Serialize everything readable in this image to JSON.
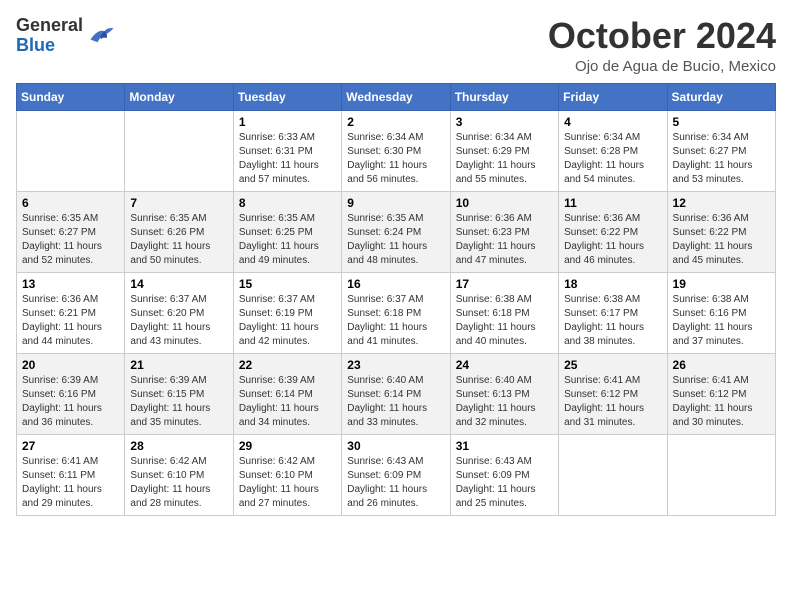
{
  "header": {
    "logo_general": "General",
    "logo_blue": "Blue",
    "month_title": "October 2024",
    "subtitle": "Ojo de Agua de Bucio, Mexico"
  },
  "weekdays": [
    "Sunday",
    "Monday",
    "Tuesday",
    "Wednesday",
    "Thursday",
    "Friday",
    "Saturday"
  ],
  "weeks": [
    [
      {
        "day": "",
        "sunrise": "",
        "sunset": "",
        "daylight": ""
      },
      {
        "day": "",
        "sunrise": "",
        "sunset": "",
        "daylight": ""
      },
      {
        "day": "1",
        "sunrise": "Sunrise: 6:33 AM",
        "sunset": "Sunset: 6:31 PM",
        "daylight": "Daylight: 11 hours and 57 minutes."
      },
      {
        "day": "2",
        "sunrise": "Sunrise: 6:34 AM",
        "sunset": "Sunset: 6:30 PM",
        "daylight": "Daylight: 11 hours and 56 minutes."
      },
      {
        "day": "3",
        "sunrise": "Sunrise: 6:34 AM",
        "sunset": "Sunset: 6:29 PM",
        "daylight": "Daylight: 11 hours and 55 minutes."
      },
      {
        "day": "4",
        "sunrise": "Sunrise: 6:34 AM",
        "sunset": "Sunset: 6:28 PM",
        "daylight": "Daylight: 11 hours and 54 minutes."
      },
      {
        "day": "5",
        "sunrise": "Sunrise: 6:34 AM",
        "sunset": "Sunset: 6:27 PM",
        "daylight": "Daylight: 11 hours and 53 minutes."
      }
    ],
    [
      {
        "day": "6",
        "sunrise": "Sunrise: 6:35 AM",
        "sunset": "Sunset: 6:27 PM",
        "daylight": "Daylight: 11 hours and 52 minutes."
      },
      {
        "day": "7",
        "sunrise": "Sunrise: 6:35 AM",
        "sunset": "Sunset: 6:26 PM",
        "daylight": "Daylight: 11 hours and 50 minutes."
      },
      {
        "day": "8",
        "sunrise": "Sunrise: 6:35 AM",
        "sunset": "Sunset: 6:25 PM",
        "daylight": "Daylight: 11 hours and 49 minutes."
      },
      {
        "day": "9",
        "sunrise": "Sunrise: 6:35 AM",
        "sunset": "Sunset: 6:24 PM",
        "daylight": "Daylight: 11 hours and 48 minutes."
      },
      {
        "day": "10",
        "sunrise": "Sunrise: 6:36 AM",
        "sunset": "Sunset: 6:23 PM",
        "daylight": "Daylight: 11 hours and 47 minutes."
      },
      {
        "day": "11",
        "sunrise": "Sunrise: 6:36 AM",
        "sunset": "Sunset: 6:22 PM",
        "daylight": "Daylight: 11 hours and 46 minutes."
      },
      {
        "day": "12",
        "sunrise": "Sunrise: 6:36 AM",
        "sunset": "Sunset: 6:22 PM",
        "daylight": "Daylight: 11 hours and 45 minutes."
      }
    ],
    [
      {
        "day": "13",
        "sunrise": "Sunrise: 6:36 AM",
        "sunset": "Sunset: 6:21 PM",
        "daylight": "Daylight: 11 hours and 44 minutes."
      },
      {
        "day": "14",
        "sunrise": "Sunrise: 6:37 AM",
        "sunset": "Sunset: 6:20 PM",
        "daylight": "Daylight: 11 hours and 43 minutes."
      },
      {
        "day": "15",
        "sunrise": "Sunrise: 6:37 AM",
        "sunset": "Sunset: 6:19 PM",
        "daylight": "Daylight: 11 hours and 42 minutes."
      },
      {
        "day": "16",
        "sunrise": "Sunrise: 6:37 AM",
        "sunset": "Sunset: 6:18 PM",
        "daylight": "Daylight: 11 hours and 41 minutes."
      },
      {
        "day": "17",
        "sunrise": "Sunrise: 6:38 AM",
        "sunset": "Sunset: 6:18 PM",
        "daylight": "Daylight: 11 hours and 40 minutes."
      },
      {
        "day": "18",
        "sunrise": "Sunrise: 6:38 AM",
        "sunset": "Sunset: 6:17 PM",
        "daylight": "Daylight: 11 hours and 38 minutes."
      },
      {
        "day": "19",
        "sunrise": "Sunrise: 6:38 AM",
        "sunset": "Sunset: 6:16 PM",
        "daylight": "Daylight: 11 hours and 37 minutes."
      }
    ],
    [
      {
        "day": "20",
        "sunrise": "Sunrise: 6:39 AM",
        "sunset": "Sunset: 6:16 PM",
        "daylight": "Daylight: 11 hours and 36 minutes."
      },
      {
        "day": "21",
        "sunrise": "Sunrise: 6:39 AM",
        "sunset": "Sunset: 6:15 PM",
        "daylight": "Daylight: 11 hours and 35 minutes."
      },
      {
        "day": "22",
        "sunrise": "Sunrise: 6:39 AM",
        "sunset": "Sunset: 6:14 PM",
        "daylight": "Daylight: 11 hours and 34 minutes."
      },
      {
        "day": "23",
        "sunrise": "Sunrise: 6:40 AM",
        "sunset": "Sunset: 6:14 PM",
        "daylight": "Daylight: 11 hours and 33 minutes."
      },
      {
        "day": "24",
        "sunrise": "Sunrise: 6:40 AM",
        "sunset": "Sunset: 6:13 PM",
        "daylight": "Daylight: 11 hours and 32 minutes."
      },
      {
        "day": "25",
        "sunrise": "Sunrise: 6:41 AM",
        "sunset": "Sunset: 6:12 PM",
        "daylight": "Daylight: 11 hours and 31 minutes."
      },
      {
        "day": "26",
        "sunrise": "Sunrise: 6:41 AM",
        "sunset": "Sunset: 6:12 PM",
        "daylight": "Daylight: 11 hours and 30 minutes."
      }
    ],
    [
      {
        "day": "27",
        "sunrise": "Sunrise: 6:41 AM",
        "sunset": "Sunset: 6:11 PM",
        "daylight": "Daylight: 11 hours and 29 minutes."
      },
      {
        "day": "28",
        "sunrise": "Sunrise: 6:42 AM",
        "sunset": "Sunset: 6:10 PM",
        "daylight": "Daylight: 11 hours and 28 minutes."
      },
      {
        "day": "29",
        "sunrise": "Sunrise: 6:42 AM",
        "sunset": "Sunset: 6:10 PM",
        "daylight": "Daylight: 11 hours and 27 minutes."
      },
      {
        "day": "30",
        "sunrise": "Sunrise: 6:43 AM",
        "sunset": "Sunset: 6:09 PM",
        "daylight": "Daylight: 11 hours and 26 minutes."
      },
      {
        "day": "31",
        "sunrise": "Sunrise: 6:43 AM",
        "sunset": "Sunset: 6:09 PM",
        "daylight": "Daylight: 11 hours and 25 minutes."
      },
      {
        "day": "",
        "sunrise": "",
        "sunset": "",
        "daylight": ""
      },
      {
        "day": "",
        "sunrise": "",
        "sunset": "",
        "daylight": ""
      }
    ]
  ]
}
